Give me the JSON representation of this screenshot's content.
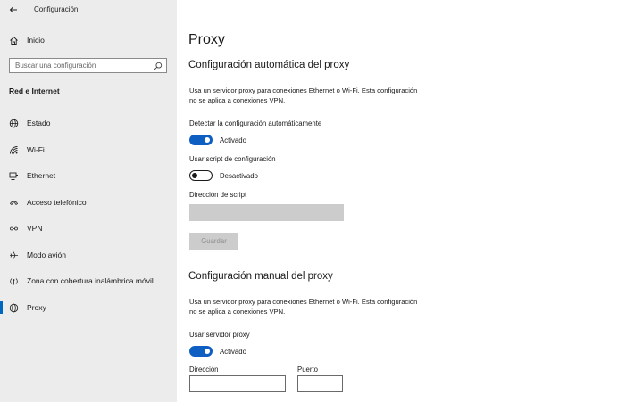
{
  "window": {
    "title": "Configuración"
  },
  "sidebar": {
    "home": "Inicio",
    "search_placeholder": "Buscar una configuración",
    "section": "Red e Internet",
    "items": [
      {
        "label": "Estado",
        "icon": "globe-icon"
      },
      {
        "label": "Wi-Fi",
        "icon": "wifi-icon"
      },
      {
        "label": "Ethernet",
        "icon": "ethernet-icon"
      },
      {
        "label": "Acceso telefónico",
        "icon": "phone-icon"
      },
      {
        "label": "VPN",
        "icon": "vpn-icon"
      },
      {
        "label": "Modo avión",
        "icon": "airplane-icon"
      },
      {
        "label": "Zona con cobertura inalámbrica móvil",
        "icon": "hotspot-icon"
      },
      {
        "label": "Proxy",
        "icon": "globe-icon",
        "active": true
      }
    ]
  },
  "main": {
    "title": "Proxy",
    "auto": {
      "heading": "Configuración automática del proxy",
      "description": "Usa un servidor proxy para conexiones Ethernet o Wi-Fi. Esta configuración no se aplica a conexiones VPN.",
      "detect_label": "Detectar la configuración automáticamente",
      "detect_state": "Activado",
      "script_label": "Usar script de configuración",
      "script_state": "Desactivado",
      "script_address_label": "Dirección de script",
      "script_address_value": "",
      "save_label": "Guardar"
    },
    "manual": {
      "heading": "Configuración manual del proxy",
      "description": "Usa un servidor proxy para conexiones Ethernet o Wi-Fi. Esta configuración no se aplica a conexiones VPN.",
      "server_label": "Usar servidor proxy",
      "server_state": "Activado",
      "address_label": "Dirección",
      "address_value": "",
      "port_label": "Puerto",
      "port_value": ""
    }
  },
  "colors": {
    "accent": "#0f5fc2",
    "sidebar_bg": "#ececec",
    "disabled": "#cccccc"
  }
}
